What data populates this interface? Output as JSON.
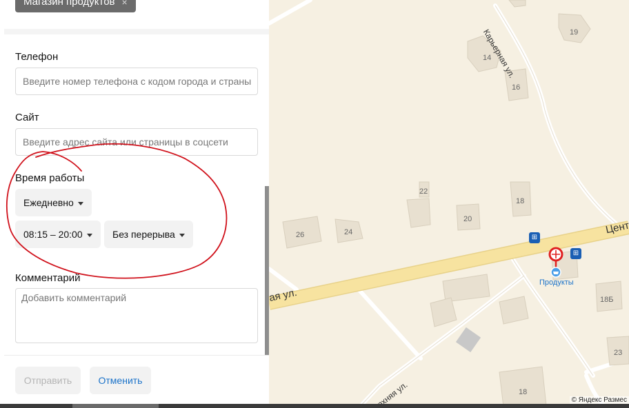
{
  "form": {
    "chip_label": "Магазин продуктов",
    "chip_close": "×",
    "phone": {
      "label": "Телефон",
      "placeholder": "Введите номер телефона с кодом города и страны"
    },
    "site": {
      "label": "Сайт",
      "placeholder": "Введите адрес сайта или страницы в соцсети"
    },
    "hours": {
      "label": "Время работы",
      "days": "Ежедневно",
      "time": "08:15 – 20:00",
      "break": "Без перерыва"
    },
    "comment": {
      "label": "Комментарий",
      "placeholder": "Добавить комментарий"
    },
    "submit_label": "Отправить",
    "cancel_label": "Отменить"
  },
  "map": {
    "streets": {
      "karernaya": "Карьерная ул.",
      "tsent": "Цент",
      "ya_ul": "ая ул.",
      "verkhnyaya": "Верхняя ул."
    },
    "house_numbers": [
      "19",
      "14",
      "16",
      "22",
      "18",
      "20",
      "26",
      "24",
      "18Б",
      "23",
      "18"
    ],
    "poi_label": "Продукты",
    "bus_stop_glyph": "⊞",
    "copyright": "© Яндекс   Размес"
  },
  "colors": {
    "map_bg": "#f6f0e2",
    "road_main": "#f7e3a0",
    "building": "#e8e0d0",
    "accent_link": "#1a72c9",
    "scribble": "#d0111b",
    "marker_red": "#e02020",
    "bus_blue": "#1a5fb4"
  }
}
